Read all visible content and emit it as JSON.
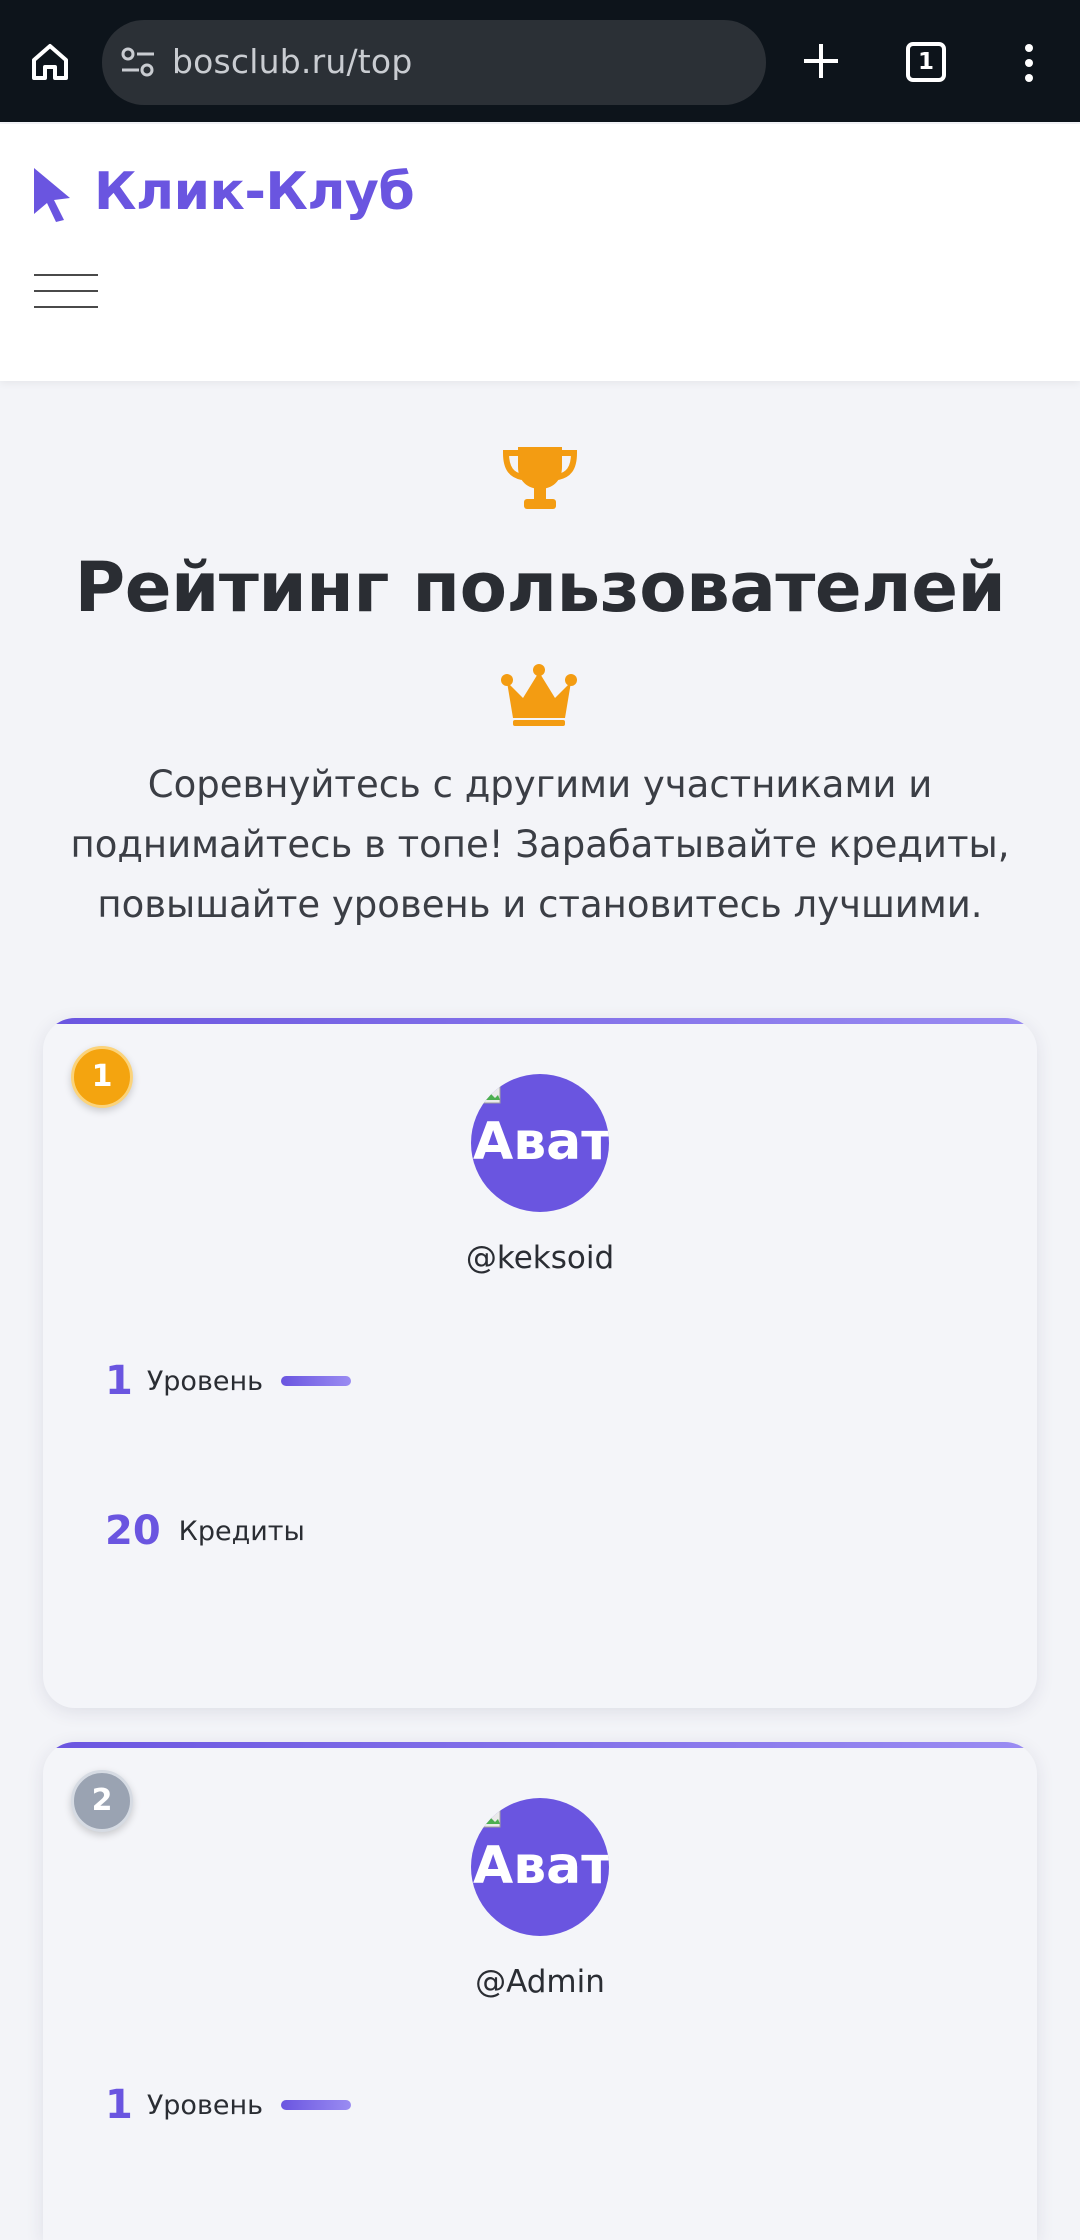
{
  "browser": {
    "url": "bosclub.ru/top",
    "tab_count": "1",
    "icons": [
      "home-icon",
      "site-settings-icon",
      "new-tab-icon",
      "tab-switcher-icon",
      "more-menu-icon"
    ]
  },
  "header": {
    "brand": "Клик-Клуб",
    "brand_icon": "cursor-pointer-icon",
    "menu_icon": "hamburger-menu-icon"
  },
  "hero": {
    "title": "Рейтинг пользователей",
    "description": "Соревнуйтесь с другими участниками и поднимайтесь в топе! Зарабатывайте кредиты, повышайте уровень и становитесь лучшими.",
    "icons": [
      "trophy-icon",
      "crown-icon"
    ]
  },
  "leaderboard": [
    {
      "rank": "1",
      "avatar_alt": "Аватар",
      "username": "@keksoid",
      "level": "1",
      "level_label": "Уровень",
      "credits": "20",
      "credits_label": "Кредиты"
    },
    {
      "rank": "2",
      "avatar_alt": "Аватар",
      "username": "@Admin",
      "level": "1",
      "level_label": "Уровень"
    }
  ],
  "colors": {
    "accent": "#6a55e0",
    "gold": "#f4a40f",
    "silver": "#9aa3b2",
    "trophy": "#f39c12",
    "browser_bar": "#0d141b"
  }
}
